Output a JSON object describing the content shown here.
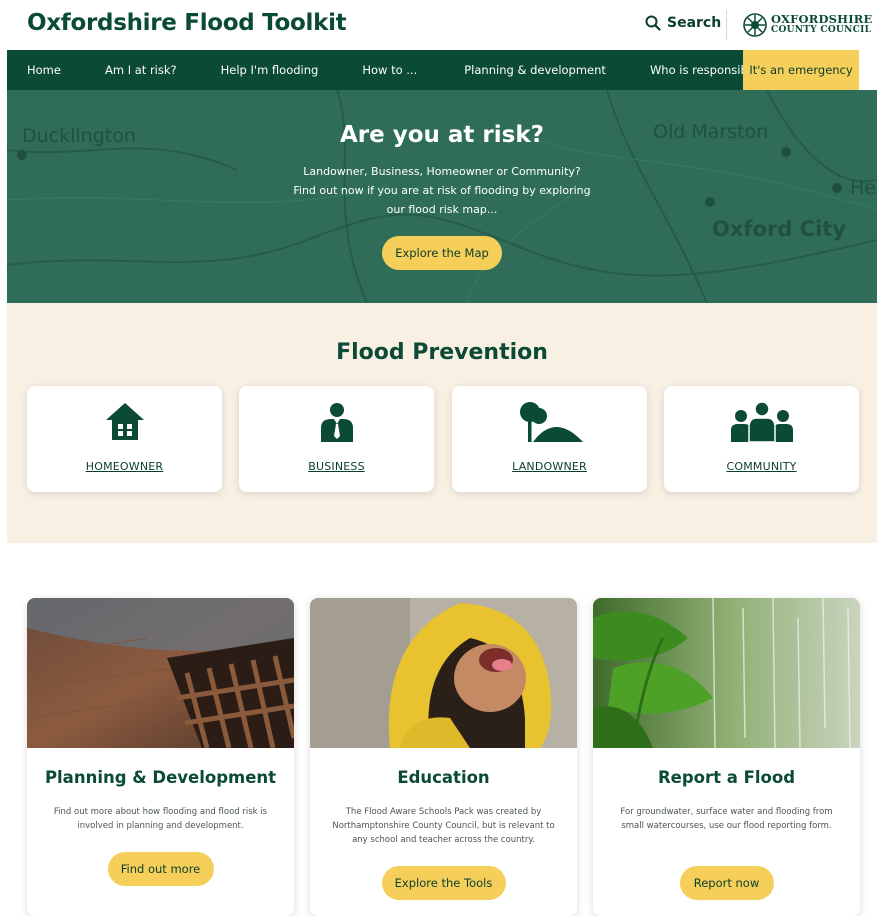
{
  "header": {
    "site_title": "Oxfordshire Flood Toolkit",
    "search_label": "Search",
    "council_line1": "OXFORDSHIRE",
    "council_line2": "COUNTY COUNCIL"
  },
  "nav": {
    "items": [
      "Home",
      "Am I at risk?",
      "Help I'm flooding",
      "How to ...",
      "Planning & development",
      "Who is responsible?"
    ],
    "emergency_label": "It's an emergency",
    "emergency_color": "#f5cf5a",
    "bar_color": "#0b4a36"
  },
  "hero": {
    "title": "Are you at risk?",
    "text": "Landowner, Business, Homeowner or Community? Find out now if you are at risk of flooding by exploring our flood risk map...",
    "button_label": "Explore the Map",
    "map_labels": [
      "Ducklington",
      "Old Marston",
      "Oxford City",
      "He"
    ]
  },
  "prevention": {
    "title": "Flood Prevention",
    "cards": [
      {
        "label": "HOMEOWNER",
        "icon": "house-icon"
      },
      {
        "label": "BUSINESS",
        "icon": "business-person-icon"
      },
      {
        "label": "LANDOWNER",
        "icon": "tree-hill-icon"
      },
      {
        "label": "COMMUNITY",
        "icon": "group-people-icon"
      }
    ]
  },
  "cards": [
    {
      "title": "Planning & Development",
      "text": "Find out more about how flooding and flood risk is involved in planning and development.",
      "button_label": "Find out more",
      "image": "storm-drain-grate"
    },
    {
      "title": "Education",
      "text": "The Flood Aware Schools Pack was created by Northamptonshire County Council, but is relevant to any school and teacher across the country.",
      "button_label": "Explore the Tools",
      "image": "child-in-yellow-raincoat"
    },
    {
      "title": "Report a Flood",
      "text": "For groundwater, surface water and flooding from small watercourses, use our flood reporting form.",
      "button_label": "Report now",
      "image": "leaves-in-rain"
    }
  ]
}
